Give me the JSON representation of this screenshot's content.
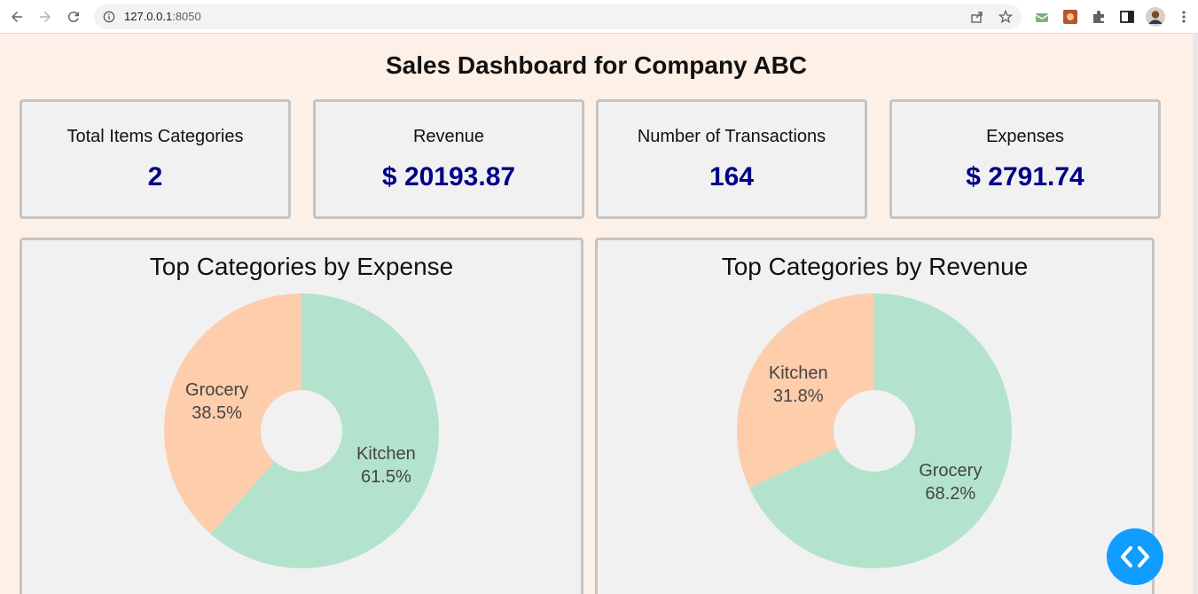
{
  "browser": {
    "url_host": "127.0.0.1",
    "url_port": ":8050",
    "icons": [
      "back-icon",
      "forward-icon",
      "reload-icon",
      "info-icon",
      "share-icon",
      "star-icon",
      "extension-icon",
      "puzzle-icon",
      "sidebar-icon",
      "profile-avatar",
      "menu-icon"
    ]
  },
  "page": {
    "title": "Sales Dashboard for Company ABC"
  },
  "kpis": [
    {
      "label": "Total Items Categories",
      "value": "2"
    },
    {
      "label": "Revenue",
      "value": "$ 20193.87"
    },
    {
      "label": "Number of Transactions",
      "value": "164"
    },
    {
      "label": "Expenses",
      "value": "$ 2791.74"
    }
  ],
  "colors": {
    "accent_value": "#000088",
    "slice_green": "#b3e2cd",
    "slice_orange": "#fdcdac",
    "fab": "#119dff",
    "background": "#fdf0e6",
    "card": "#f1f1f1"
  },
  "chart_data": [
    {
      "type": "pie",
      "title": "Top Categories by Expense",
      "hole": true,
      "categories": [
        "Kitchen",
        "Grocery"
      ],
      "values": [
        61.5,
        38.5
      ],
      "labels": [
        "61.5%",
        "38.5%"
      ],
      "colors": [
        "#b3e2cd",
        "#fdcdac"
      ]
    },
    {
      "type": "pie",
      "title": "Top Categories by Revenue",
      "hole": true,
      "categories": [
        "Grocery",
        "Kitchen"
      ],
      "values": [
        68.2,
        31.8
      ],
      "labels": [
        "68.2%",
        "31.8%"
      ],
      "colors": [
        "#b3e2cd",
        "#fdcdac"
      ]
    }
  ]
}
